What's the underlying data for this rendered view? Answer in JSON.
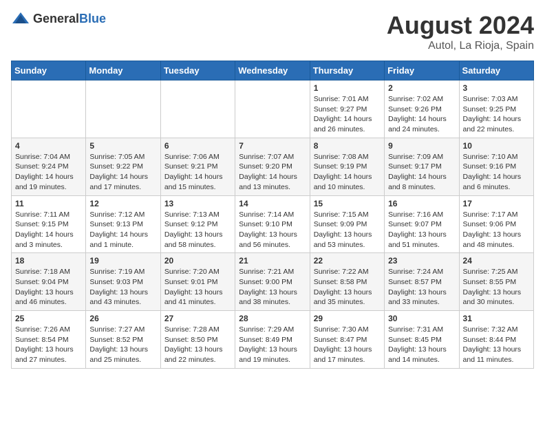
{
  "header": {
    "logo_general": "General",
    "logo_blue": "Blue",
    "month_year": "August 2024",
    "location": "Autol, La Rioja, Spain"
  },
  "weekdays": [
    "Sunday",
    "Monday",
    "Tuesday",
    "Wednesday",
    "Thursday",
    "Friday",
    "Saturday"
  ],
  "weeks": [
    [
      {
        "day": "",
        "sunrise": "",
        "sunset": "",
        "daylight": ""
      },
      {
        "day": "",
        "sunrise": "",
        "sunset": "",
        "daylight": ""
      },
      {
        "day": "",
        "sunrise": "",
        "sunset": "",
        "daylight": ""
      },
      {
        "day": "",
        "sunrise": "",
        "sunset": "",
        "daylight": ""
      },
      {
        "day": "1",
        "sunrise": "Sunrise: 7:01 AM",
        "sunset": "Sunset: 9:27 PM",
        "daylight": "Daylight: 14 hours and 26 minutes."
      },
      {
        "day": "2",
        "sunrise": "Sunrise: 7:02 AM",
        "sunset": "Sunset: 9:26 PM",
        "daylight": "Daylight: 14 hours and 24 minutes."
      },
      {
        "day": "3",
        "sunrise": "Sunrise: 7:03 AM",
        "sunset": "Sunset: 9:25 PM",
        "daylight": "Daylight: 14 hours and 22 minutes."
      }
    ],
    [
      {
        "day": "4",
        "sunrise": "Sunrise: 7:04 AM",
        "sunset": "Sunset: 9:24 PM",
        "daylight": "Daylight: 14 hours and 19 minutes."
      },
      {
        "day": "5",
        "sunrise": "Sunrise: 7:05 AM",
        "sunset": "Sunset: 9:22 PM",
        "daylight": "Daylight: 14 hours and 17 minutes."
      },
      {
        "day": "6",
        "sunrise": "Sunrise: 7:06 AM",
        "sunset": "Sunset: 9:21 PM",
        "daylight": "Daylight: 14 hours and 15 minutes."
      },
      {
        "day": "7",
        "sunrise": "Sunrise: 7:07 AM",
        "sunset": "Sunset: 9:20 PM",
        "daylight": "Daylight: 14 hours and 13 minutes."
      },
      {
        "day": "8",
        "sunrise": "Sunrise: 7:08 AM",
        "sunset": "Sunset: 9:19 PM",
        "daylight": "Daylight: 14 hours and 10 minutes."
      },
      {
        "day": "9",
        "sunrise": "Sunrise: 7:09 AM",
        "sunset": "Sunset: 9:17 PM",
        "daylight": "Daylight: 14 hours and 8 minutes."
      },
      {
        "day": "10",
        "sunrise": "Sunrise: 7:10 AM",
        "sunset": "Sunset: 9:16 PM",
        "daylight": "Daylight: 14 hours and 6 minutes."
      }
    ],
    [
      {
        "day": "11",
        "sunrise": "Sunrise: 7:11 AM",
        "sunset": "Sunset: 9:15 PM",
        "daylight": "Daylight: 14 hours and 3 minutes."
      },
      {
        "day": "12",
        "sunrise": "Sunrise: 7:12 AM",
        "sunset": "Sunset: 9:13 PM",
        "daylight": "Daylight: 14 hours and 1 minute."
      },
      {
        "day": "13",
        "sunrise": "Sunrise: 7:13 AM",
        "sunset": "Sunset: 9:12 PM",
        "daylight": "Daylight: 13 hours and 58 minutes."
      },
      {
        "day": "14",
        "sunrise": "Sunrise: 7:14 AM",
        "sunset": "Sunset: 9:10 PM",
        "daylight": "Daylight: 13 hours and 56 minutes."
      },
      {
        "day": "15",
        "sunrise": "Sunrise: 7:15 AM",
        "sunset": "Sunset: 9:09 PM",
        "daylight": "Daylight: 13 hours and 53 minutes."
      },
      {
        "day": "16",
        "sunrise": "Sunrise: 7:16 AM",
        "sunset": "Sunset: 9:07 PM",
        "daylight": "Daylight: 13 hours and 51 minutes."
      },
      {
        "day": "17",
        "sunrise": "Sunrise: 7:17 AM",
        "sunset": "Sunset: 9:06 PM",
        "daylight": "Daylight: 13 hours and 48 minutes."
      }
    ],
    [
      {
        "day": "18",
        "sunrise": "Sunrise: 7:18 AM",
        "sunset": "Sunset: 9:04 PM",
        "daylight": "Daylight: 13 hours and 46 minutes."
      },
      {
        "day": "19",
        "sunrise": "Sunrise: 7:19 AM",
        "sunset": "Sunset: 9:03 PM",
        "daylight": "Daylight: 13 hours and 43 minutes."
      },
      {
        "day": "20",
        "sunrise": "Sunrise: 7:20 AM",
        "sunset": "Sunset: 9:01 PM",
        "daylight": "Daylight: 13 hours and 41 minutes."
      },
      {
        "day": "21",
        "sunrise": "Sunrise: 7:21 AM",
        "sunset": "Sunset: 9:00 PM",
        "daylight": "Daylight: 13 hours and 38 minutes."
      },
      {
        "day": "22",
        "sunrise": "Sunrise: 7:22 AM",
        "sunset": "Sunset: 8:58 PM",
        "daylight": "Daylight: 13 hours and 35 minutes."
      },
      {
        "day": "23",
        "sunrise": "Sunrise: 7:24 AM",
        "sunset": "Sunset: 8:57 PM",
        "daylight": "Daylight: 13 hours and 33 minutes."
      },
      {
        "day": "24",
        "sunrise": "Sunrise: 7:25 AM",
        "sunset": "Sunset: 8:55 PM",
        "daylight": "Daylight: 13 hours and 30 minutes."
      }
    ],
    [
      {
        "day": "25",
        "sunrise": "Sunrise: 7:26 AM",
        "sunset": "Sunset: 8:54 PM",
        "daylight": "Daylight: 13 hours and 27 minutes."
      },
      {
        "day": "26",
        "sunrise": "Sunrise: 7:27 AM",
        "sunset": "Sunset: 8:52 PM",
        "daylight": "Daylight: 13 hours and 25 minutes."
      },
      {
        "day": "27",
        "sunrise": "Sunrise: 7:28 AM",
        "sunset": "Sunset: 8:50 PM",
        "daylight": "Daylight: 13 hours and 22 minutes."
      },
      {
        "day": "28",
        "sunrise": "Sunrise: 7:29 AM",
        "sunset": "Sunset: 8:49 PM",
        "daylight": "Daylight: 13 hours and 19 minutes."
      },
      {
        "day": "29",
        "sunrise": "Sunrise: 7:30 AM",
        "sunset": "Sunset: 8:47 PM",
        "daylight": "Daylight: 13 hours and 17 minutes."
      },
      {
        "day": "30",
        "sunrise": "Sunrise: 7:31 AM",
        "sunset": "Sunset: 8:45 PM",
        "daylight": "Daylight: 13 hours and 14 minutes."
      },
      {
        "day": "31",
        "sunrise": "Sunrise: 7:32 AM",
        "sunset": "Sunset: 8:44 PM",
        "daylight": "Daylight: 13 hours and 11 minutes."
      }
    ]
  ]
}
